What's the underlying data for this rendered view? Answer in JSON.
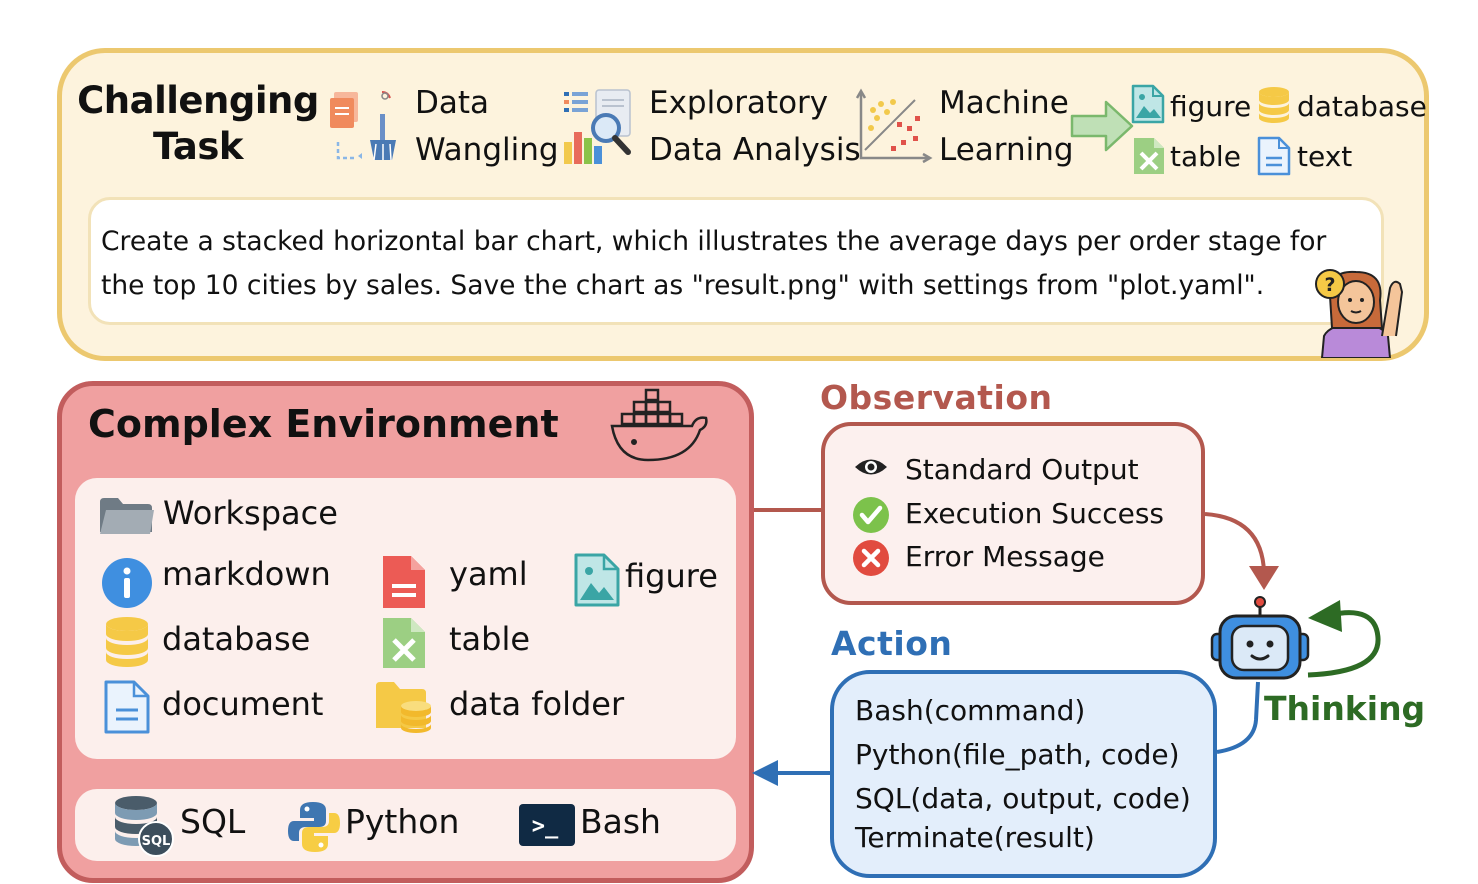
{
  "task": {
    "title_line1": "Challenging",
    "title_line2": "Task",
    "categories": [
      {
        "line1": "Data",
        "line2": "Wangling"
      },
      {
        "line1": "Exploratory",
        "line2": "Data Analysis"
      },
      {
        "line1": "Machine",
        "line2": "Learning"
      }
    ],
    "outputs": [
      "figure",
      "database",
      "table",
      "text"
    ],
    "instruction_line1": "Create a stacked horizontal bar chart, which illustrates the average days per order stage for",
    "instruction_line2": "the top 10 cities by sales. Save the chart as \"result.png\" with settings from \"plot.yaml\"."
  },
  "environment": {
    "title": "Complex Environment",
    "workspace": "Workspace",
    "files": [
      "markdown",
      "yaml",
      "figure",
      "database",
      "table",
      "document",
      "data folder"
    ],
    "tools": [
      "SQL",
      "Python",
      "Bash"
    ],
    "sql_badge": "SQL",
    "bash_prompt": ">_"
  },
  "observation": {
    "heading": "Observation",
    "items": [
      "Standard Output",
      "Execution Success",
      "Error Message"
    ]
  },
  "action": {
    "heading": "Action",
    "items": [
      "Bash(command)",
      "Python(file_path, code)",
      "SQL(data, output, code)",
      "Terminate(result)"
    ]
  },
  "agent": {
    "thinking": "Thinking",
    "question_mark": "?"
  },
  "colors": {
    "task_border": "#ecc86f",
    "task_fill": "#fdf3dd",
    "env_border": "#c25d5d",
    "env_fill": "#f0a0a0",
    "observation": "#b3584e",
    "action": "#2f6fb5",
    "thinking": "#2d6b24",
    "arrow_green": "#7ab86c"
  }
}
